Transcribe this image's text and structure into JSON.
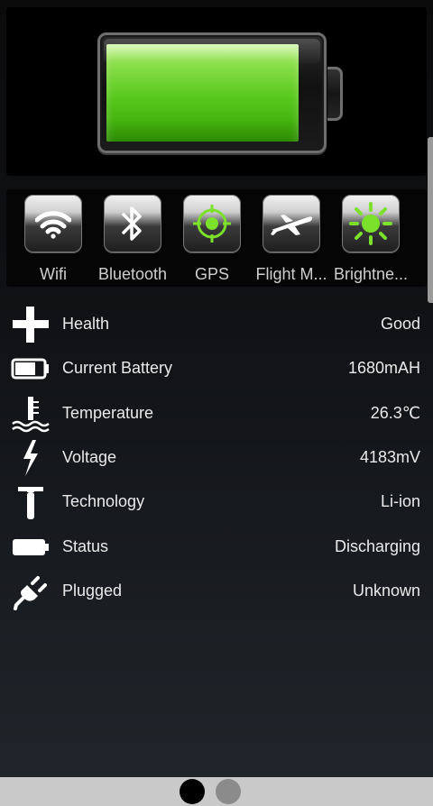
{
  "battery": {
    "level": 0.91,
    "fill_color": "#58c81d"
  },
  "toggles": [
    {
      "label": "Wifi",
      "icon": "wifi-icon"
    },
    {
      "label": "Bluetooth",
      "icon": "bluetooth-icon"
    },
    {
      "label": "GPS",
      "icon": "gps-icon"
    },
    {
      "label": "Flight M...",
      "icon": "airplane-icon"
    },
    {
      "label": "Brightne...",
      "icon": "brightness-icon"
    }
  ],
  "info": [
    {
      "label": "Health",
      "value": "Good",
      "icon": "health-cross-icon"
    },
    {
      "label": "Current Battery",
      "value": "1680mAH",
      "icon": "battery-small-icon"
    },
    {
      "label": "Temperature",
      "value": "26.3℃",
      "icon": "thermometer-icon"
    },
    {
      "label": "Voltage",
      "value": "4183mV",
      "icon": "lightning-icon"
    },
    {
      "label": "Technology",
      "value": "Li-ion",
      "icon": "hammer-icon"
    },
    {
      "label": "Status",
      "value": "Discharging",
      "icon": "battery-status-icon"
    },
    {
      "label": "Plugged",
      "value": "Unknown",
      "icon": "plug-icon"
    }
  ],
  "pager": {
    "pages": 2,
    "current": 1
  },
  "colors": {
    "accent_green": "#7be12b",
    "text": "#eaeaea"
  }
}
